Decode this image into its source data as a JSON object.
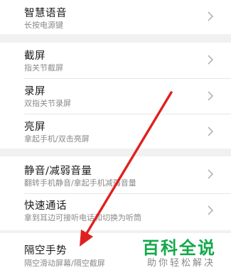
{
  "settings": {
    "items": [
      {
        "title": "智慧语音",
        "subtitle": "长按电源键"
      },
      {
        "title": "截屏",
        "subtitle": "指关节截屏"
      },
      {
        "title": "录屏",
        "subtitle": "双指关节录屏"
      },
      {
        "title": "亮屏",
        "subtitle": "拿起手机/双击亮屏"
      },
      {
        "title": "静音/减弱音量",
        "subtitle": "翻转手机静音/拿起手机减弱音量"
      },
      {
        "title": "快速通话",
        "subtitle": "拿到耳边可接听电话和切换为听筒"
      },
      {
        "title": "隔空手势",
        "subtitle": "隔空滑动屏幕/隔空截屏"
      }
    ]
  },
  "watermark": {
    "main": "百科全说",
    "sub": "助你轻松解决"
  },
  "annotation": {
    "arrow_color": "#e02020"
  }
}
